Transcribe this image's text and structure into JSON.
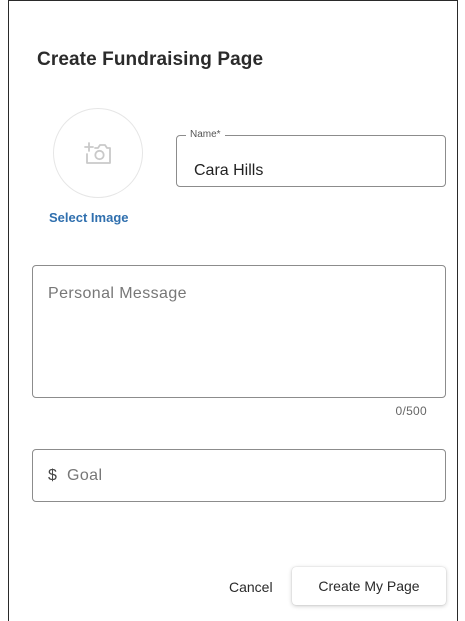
{
  "dialog": {
    "title": "Create Fundraising Page"
  },
  "avatar": {
    "icon": "add-photo-icon",
    "select_label": "Select Image"
  },
  "name_field": {
    "label": "Name*",
    "value": "Cara Hills"
  },
  "message_field": {
    "placeholder": "Personal Message",
    "counter": "0/500"
  },
  "goal_field": {
    "prefix": "$",
    "placeholder": "Goal"
  },
  "actions": {
    "cancel_label": "Cancel",
    "create_label": "Create My Page"
  },
  "colors": {
    "accent": "#2f6fae",
    "border": "#8c8c8c"
  }
}
